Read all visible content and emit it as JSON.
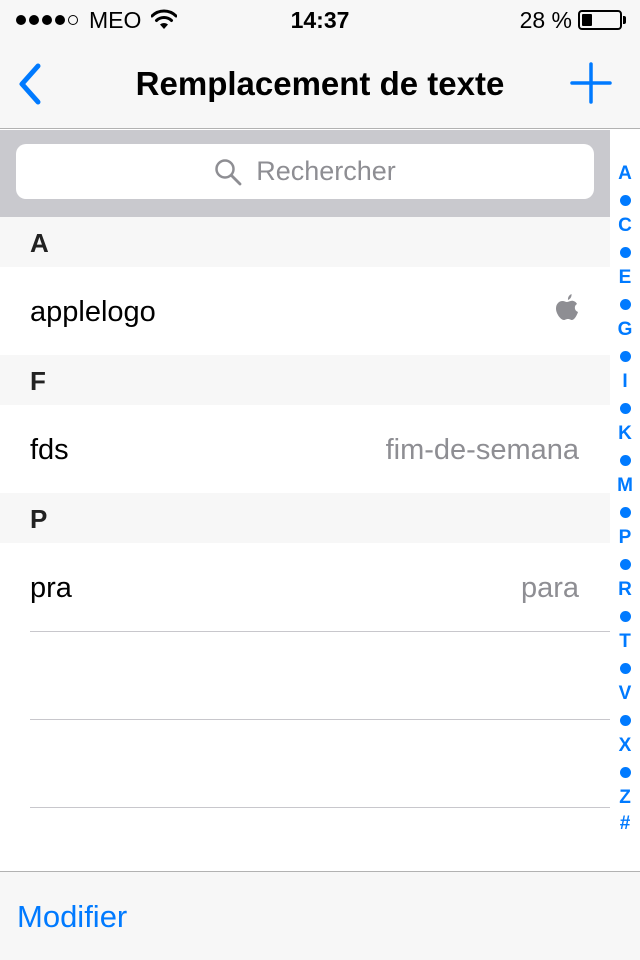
{
  "status_bar": {
    "signal_bars_filled": 4,
    "signal_bars_total": 5,
    "carrier": "MEO",
    "time": "14:37",
    "battery_text": "28 %",
    "battery_level": 0.28
  },
  "nav": {
    "back_icon": "chevron-left-icon",
    "title": "Remplacement de texte",
    "add_icon": "plus-icon"
  },
  "search": {
    "icon": "search-icon",
    "placeholder": "Rechercher"
  },
  "sections": [
    {
      "header": "A",
      "rows": [
        {
          "phrase": "applelogo",
          "value": "",
          "value_icon": "apple-logo-icon"
        }
      ]
    },
    {
      "header": "F",
      "rows": [
        {
          "phrase": "fds",
          "value": "fim-de-semana"
        }
      ]
    },
    {
      "header": "P",
      "rows": [
        {
          "phrase": "pra",
          "value": "para"
        }
      ]
    }
  ],
  "index": [
    "A",
    "•",
    "C",
    "•",
    "E",
    "•",
    "G",
    "•",
    "I",
    "•",
    "K",
    "•",
    "M",
    "•",
    "P",
    "•",
    "R",
    "•",
    "T",
    "•",
    "V",
    "•",
    "X",
    "•",
    "Z",
    "#"
  ],
  "toolbar": {
    "edit_label": "Modifier"
  },
  "colors": {
    "accent": "#007aff",
    "secondary_text": "#8e8e93",
    "bar_background": "#f7f7f7",
    "search_background": "#c9c9ce"
  }
}
